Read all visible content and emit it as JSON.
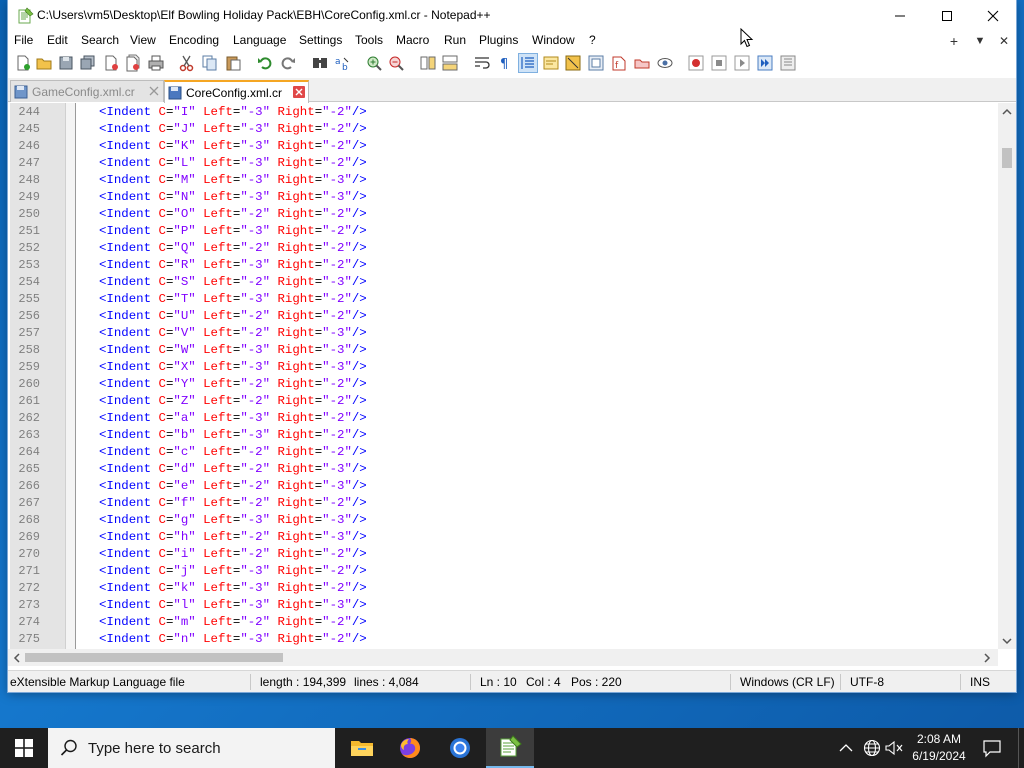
{
  "window": {
    "title": "C:\\Users\\vm5\\Desktop\\Elf Bowling Holiday Pack\\EBH\\CoreConfig.xml.cr - Notepad++"
  },
  "menu": [
    "File",
    "Edit",
    "Search",
    "View",
    "Encoding",
    "Language",
    "Settings",
    "Tools",
    "Macro",
    "Run",
    "Plugins",
    "Window",
    "?"
  ],
  "menubar_right": {
    "add": "+",
    "dropdown": "▼",
    "close": "✕"
  },
  "tabs": [
    {
      "label": "GameConfig.xml.cr",
      "active": false
    },
    {
      "label": "CoreConfig.xml.cr",
      "active": true
    }
  ],
  "editor": {
    "lines": [
      {
        "n": "244",
        "c": "I",
        "left": "-3",
        "right": "-2"
      },
      {
        "n": "245",
        "c": "J",
        "left": "-3",
        "right": "-2"
      },
      {
        "n": "246",
        "c": "K",
        "left": "-3",
        "right": "-2"
      },
      {
        "n": "247",
        "c": "L",
        "left": "-3",
        "right": "-2"
      },
      {
        "n": "248",
        "c": "M",
        "left": "-3",
        "right": "-3"
      },
      {
        "n": "249",
        "c": "N",
        "left": "-3",
        "right": "-3"
      },
      {
        "n": "250",
        "c": "O",
        "left": "-2",
        "right": "-2"
      },
      {
        "n": "251",
        "c": "P",
        "left": "-3",
        "right": "-2"
      },
      {
        "n": "252",
        "c": "Q",
        "left": "-2",
        "right": "-2"
      },
      {
        "n": "253",
        "c": "R",
        "left": "-3",
        "right": "-2"
      },
      {
        "n": "254",
        "c": "S",
        "left": "-2",
        "right": "-3"
      },
      {
        "n": "255",
        "c": "T",
        "left": "-3",
        "right": "-2"
      },
      {
        "n": "256",
        "c": "U",
        "left": "-2",
        "right": "-2"
      },
      {
        "n": "257",
        "c": "V",
        "left": "-2",
        "right": "-3"
      },
      {
        "n": "258",
        "c": "W",
        "left": "-3",
        "right": "-3"
      },
      {
        "n": "259",
        "c": "X",
        "left": "-3",
        "right": "-3"
      },
      {
        "n": "260",
        "c": "Y",
        "left": "-2",
        "right": "-2"
      },
      {
        "n": "261",
        "c": "Z",
        "left": "-2",
        "right": "-2"
      },
      {
        "n": "262",
        "c": "a",
        "left": "-3",
        "right": "-2"
      },
      {
        "n": "263",
        "c": "b",
        "left": "-3",
        "right": "-2"
      },
      {
        "n": "264",
        "c": "c",
        "left": "-2",
        "right": "-2"
      },
      {
        "n": "265",
        "c": "d",
        "left": "-2",
        "right": "-3"
      },
      {
        "n": "266",
        "c": "e",
        "left": "-2",
        "right": "-3"
      },
      {
        "n": "267",
        "c": "f",
        "left": "-2",
        "right": "-2"
      },
      {
        "n": "268",
        "c": "g",
        "left": "-3",
        "right": "-3"
      },
      {
        "n": "269",
        "c": "h",
        "left": "-2",
        "right": "-3"
      },
      {
        "n": "270",
        "c": "i",
        "left": "-2",
        "right": "-2"
      },
      {
        "n": "271",
        "c": "j",
        "left": "-3",
        "right": "-2"
      },
      {
        "n": "272",
        "c": "k",
        "left": "-3",
        "right": "-2"
      },
      {
        "n": "273",
        "c": "l",
        "left": "-3",
        "right": "-3"
      },
      {
        "n": "274",
        "c": "m",
        "left": "-2",
        "right": "-2"
      },
      {
        "n": "275",
        "c": "n",
        "left": "-3",
        "right": "-2"
      }
    ]
  },
  "statusbar": {
    "file_type": "eXtensible Markup Language file",
    "length": "length : 194,399",
    "lines": "lines : 4,084",
    "ln": "Ln : 10",
    "col": "Col : 4",
    "pos": "Pos : 220",
    "eol": "Windows (CR LF)",
    "encoding": "UTF-8",
    "mode": "INS"
  },
  "taskbar": {
    "search_placeholder": "Type here to search",
    "time": "2:08 AM",
    "date": "6/19/2024"
  },
  "colors": {
    "tag": "#0000ff",
    "attribute": "#ff0000",
    "value": "#8000ff",
    "active_tab_accent": "#f5a623"
  }
}
